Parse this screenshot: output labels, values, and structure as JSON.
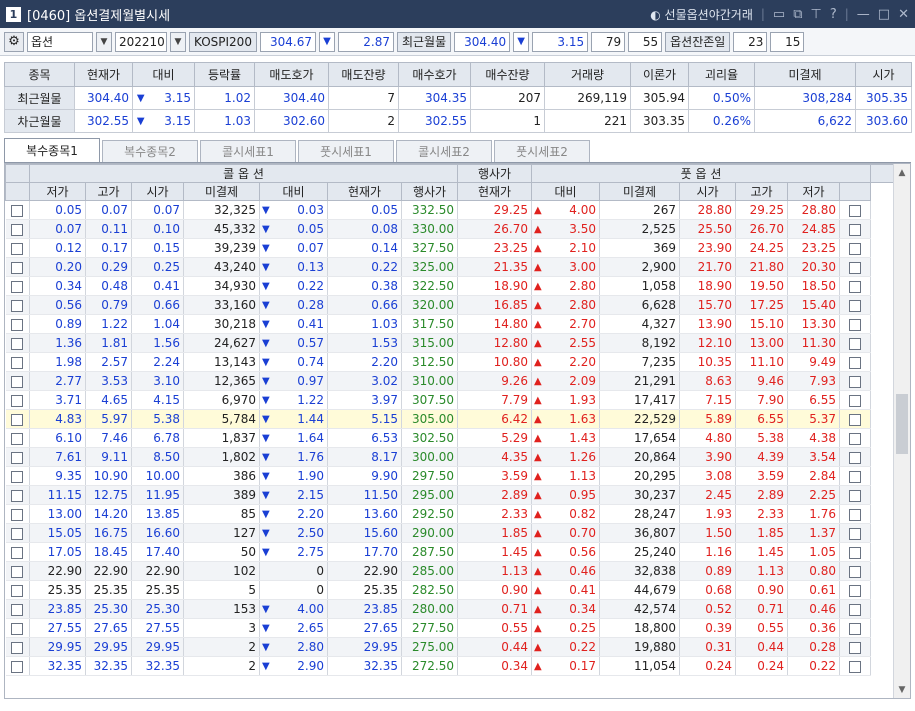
{
  "title": {
    "num": "1",
    "text": "[0460] 옵션결제월별시세",
    "right_link": "선물옵션야간거래",
    "icons": [
      "window-icon",
      "copy-icon",
      "pin-icon",
      "help-icon",
      "minimize-icon",
      "maximize-icon",
      "close-icon"
    ]
  },
  "controls": {
    "type": "옵션",
    "month": "202210",
    "index_label": "KOSPI200",
    "index_value": "304.67",
    "index_arrow": "▼",
    "index_change": "2.87",
    "near_label": "최근월물",
    "near_value": "304.40",
    "near_arrow": "▼",
    "near_change": "3.15",
    "n1": "79",
    "n2": "55",
    "remain_label": "옵션잔존일",
    "d1": "23",
    "d2": "15"
  },
  "summary": {
    "headers": [
      "종목",
      "현재가",
      "대비",
      "등락률",
      "매도호가",
      "매도잔량",
      "매수호가",
      "매수잔량",
      "거래량",
      "이론가",
      "괴리율",
      "미결제",
      "시가"
    ],
    "rows": [
      [
        "최근월물",
        "304.40",
        "▼",
        "3.15",
        "1.02",
        "304.40",
        "7",
        "304.35",
        "207",
        "269,119",
        "305.94",
        "0.50%",
        "308,284",
        "305.35"
      ],
      [
        "차근월물",
        "302.55",
        "▼",
        "3.15",
        "1.03",
        "302.60",
        "2",
        "302.55",
        "1",
        "221",
        "303.35",
        "0.26%",
        "6,622",
        "303.60"
      ]
    ]
  },
  "tabs": [
    "복수종목1",
    "복수종목2",
    "콜시세표1",
    "풋시세표1",
    "콜시세표2",
    "풋시세표2"
  ],
  "grid": {
    "group_call": "콜 옵 션",
    "group_strike": "행사가",
    "group_put": "풋 옵 션",
    "headers": [
      "저가",
      "고가",
      "시가",
      "미결제",
      "대비",
      "현재가",
      "행사가",
      "현재가",
      "대비",
      "미결제",
      "시가",
      "고가",
      "저가"
    ],
    "rows": [
      [
        "0.05",
        "0.07",
        "0.07",
        "32,325",
        "▼",
        "0.03",
        "0.05",
        "332.50",
        "29.25",
        "▲",
        "4.00",
        "267",
        "28.80",
        "29.25",
        "28.80"
      ],
      [
        "0.07",
        "0.11",
        "0.10",
        "45,332",
        "▼",
        "0.05",
        "0.08",
        "330.00",
        "26.70",
        "▲",
        "3.50",
        "2,525",
        "25.50",
        "26.70",
        "24.85"
      ],
      [
        "0.12",
        "0.17",
        "0.15",
        "39,239",
        "▼",
        "0.07",
        "0.14",
        "327.50",
        "23.25",
        "▲",
        "2.10",
        "369",
        "23.90",
        "24.25",
        "23.25"
      ],
      [
        "0.20",
        "0.29",
        "0.25",
        "43,240",
        "▼",
        "0.13",
        "0.22",
        "325.00",
        "21.35",
        "▲",
        "3.00",
        "2,900",
        "21.70",
        "21.80",
        "20.30"
      ],
      [
        "0.34",
        "0.48",
        "0.41",
        "34,930",
        "▼",
        "0.22",
        "0.38",
        "322.50",
        "18.90",
        "▲",
        "2.80",
        "1,058",
        "18.90",
        "19.50",
        "18.50"
      ],
      [
        "0.56",
        "0.79",
        "0.66",
        "33,160",
        "▼",
        "0.28",
        "0.66",
        "320.00",
        "16.85",
        "▲",
        "2.80",
        "6,628",
        "15.70",
        "17.25",
        "15.40"
      ],
      [
        "0.89",
        "1.22",
        "1.04",
        "30,218",
        "▼",
        "0.41",
        "1.03",
        "317.50",
        "14.80",
        "▲",
        "2.70",
        "4,327",
        "13.90",
        "15.10",
        "13.30"
      ],
      [
        "1.36",
        "1.81",
        "1.56",
        "24,627",
        "▼",
        "0.57",
        "1.53",
        "315.00",
        "12.80",
        "▲",
        "2.55",
        "8,192",
        "12.10",
        "13.00",
        "11.30"
      ],
      [
        "1.98",
        "2.57",
        "2.24",
        "13,143",
        "▼",
        "0.74",
        "2.20",
        "312.50",
        "10.80",
        "▲",
        "2.20",
        "7,235",
        "10.35",
        "11.10",
        "9.49"
      ],
      [
        "2.77",
        "3.53",
        "3.10",
        "12,365",
        "▼",
        "0.97",
        "3.02",
        "310.00",
        "9.26",
        "▲",
        "2.09",
        "21,291",
        "8.63",
        "9.46",
        "7.93"
      ],
      [
        "3.71",
        "4.65",
        "4.15",
        "6,970",
        "▼",
        "1.22",
        "3.97",
        "307.50",
        "7.79",
        "▲",
        "1.93",
        "17,417",
        "7.15",
        "7.90",
        "6.55"
      ],
      [
        "4.83",
        "5.97",
        "5.38",
        "5,784",
        "▼",
        "1.44",
        "5.15",
        "305.00",
        "6.42",
        "▲",
        "1.63",
        "22,529",
        "5.89",
        "6.55",
        "5.37"
      ],
      [
        "6.10",
        "7.46",
        "6.78",
        "1,837",
        "▼",
        "1.64",
        "6.53",
        "302.50",
        "5.29",
        "▲",
        "1.43",
        "17,654",
        "4.80",
        "5.38",
        "4.38"
      ],
      [
        "7.61",
        "9.11",
        "8.50",
        "1,802",
        "▼",
        "1.76",
        "8.17",
        "300.00",
        "4.35",
        "▲",
        "1.26",
        "20,864",
        "3.90",
        "4.39",
        "3.54"
      ],
      [
        "9.35",
        "10.90",
        "10.00",
        "386",
        "▼",
        "1.90",
        "9.90",
        "297.50",
        "3.59",
        "▲",
        "1.13",
        "20,295",
        "3.08",
        "3.59",
        "2.84"
      ],
      [
        "11.15",
        "12.75",
        "11.95",
        "389",
        "▼",
        "2.15",
        "11.50",
        "295.00",
        "2.89",
        "▲",
        "0.95",
        "30,237",
        "2.45",
        "2.89",
        "2.25"
      ],
      [
        "13.00",
        "14.20",
        "13.85",
        "85",
        "▼",
        "2.20",
        "13.60",
        "292.50",
        "2.33",
        "▲",
        "0.82",
        "28,247",
        "1.93",
        "2.33",
        "1.76"
      ],
      [
        "15.05",
        "16.75",
        "16.60",
        "127",
        "▼",
        "2.50",
        "15.60",
        "290.00",
        "1.85",
        "▲",
        "0.70",
        "36,807",
        "1.50",
        "1.85",
        "1.37"
      ],
      [
        "17.05",
        "18.45",
        "17.40",
        "50",
        "▼",
        "2.75",
        "17.70",
        "287.50",
        "1.45",
        "▲",
        "0.56",
        "25,240",
        "1.16",
        "1.45",
        "1.05"
      ],
      [
        "22.90",
        "22.90",
        "22.90",
        "102",
        "",
        "0",
        "22.90",
        "285.00",
        "1.13",
        "▲",
        "0.46",
        "32,838",
        "0.89",
        "1.13",
        "0.80"
      ],
      [
        "25.35",
        "25.35",
        "25.35",
        "5",
        "",
        "0",
        "25.35",
        "282.50",
        "0.90",
        "▲",
        "0.41",
        "44,679",
        "0.68",
        "0.90",
        "0.61"
      ],
      [
        "23.85",
        "25.30",
        "25.30",
        "153",
        "▼",
        "4.00",
        "23.85",
        "280.00",
        "0.71",
        "▲",
        "0.34",
        "42,574",
        "0.52",
        "0.71",
        "0.46"
      ],
      [
        "27.55",
        "27.65",
        "27.55",
        "3",
        "▼",
        "2.65",
        "27.65",
        "277.50",
        "0.55",
        "▲",
        "0.25",
        "18,800",
        "0.39",
        "0.55",
        "0.36"
      ],
      [
        "29.95",
        "29.95",
        "29.95",
        "2",
        "▼",
        "2.80",
        "29.95",
        "275.00",
        "0.44",
        "▲",
        "0.22",
        "19,880",
        "0.31",
        "0.44",
        "0.28"
      ],
      [
        "32.35",
        "32.35",
        "32.35",
        "2",
        "▼",
        "2.90",
        "32.35",
        "272.50",
        "0.34",
        "▲",
        "0.17",
        "11,054",
        "0.24",
        "0.24",
        "0.22"
      ]
    ]
  },
  "colors": {
    "up": "#e0211e",
    "down": "#1a3fd4",
    "atm_row": "#fffbd9",
    "title_bg": "#2c3e5c"
  }
}
